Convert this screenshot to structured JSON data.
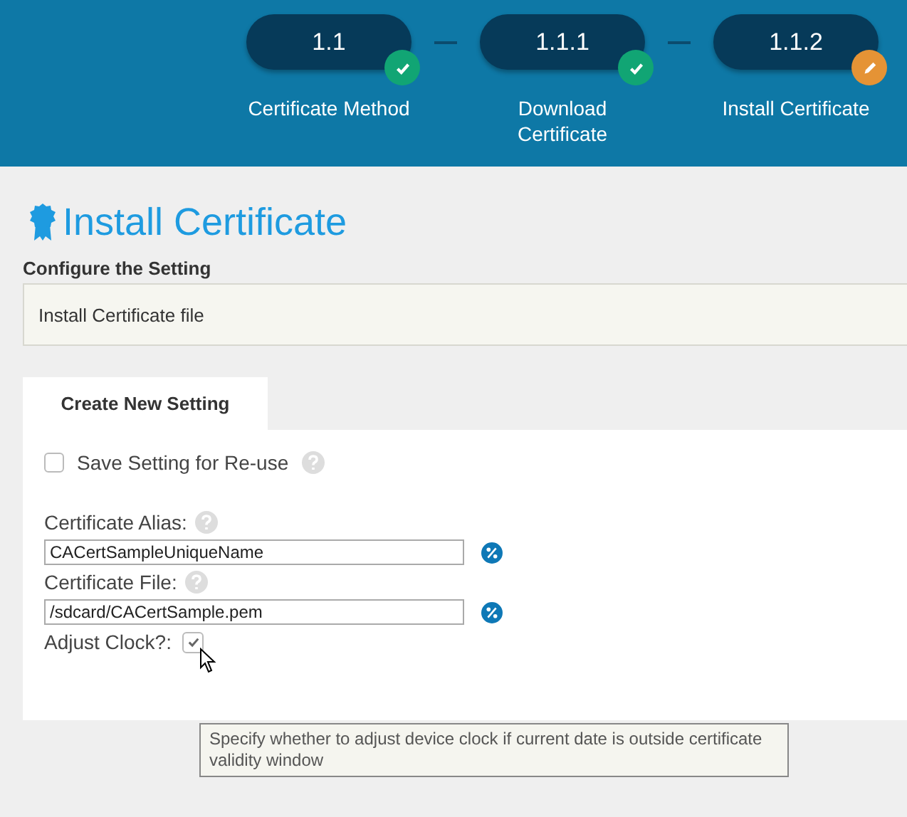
{
  "steps": [
    {
      "number": "1.1",
      "label": "Certificate Method",
      "completed": true
    },
    {
      "number": "1.1.1",
      "label": "Download Certificate",
      "completed": true
    },
    {
      "number": "1.1.2",
      "label": "Install Certificate",
      "completed": false
    }
  ],
  "page_title": "Install Certificate",
  "configure": {
    "label": "Configure the Setting",
    "value": "Install Certificate file"
  },
  "tabs": [
    {
      "label": "Create New Setting",
      "selected": true
    }
  ],
  "save_setting": {
    "label": "Save Setting for Re-use",
    "checked": false
  },
  "fields": [
    {
      "label": "Certificate Alias:",
      "value": "CACertSampleUniqueName"
    },
    {
      "label": "Certificate File:",
      "value": "/sdcard/CACertSample.pem"
    }
  ],
  "adjust_clock": {
    "label": "Adjust Clock?:",
    "checked": true
  },
  "tooltip": "Specify whether to adjust device clock if current date is outside certificate validity window"
}
